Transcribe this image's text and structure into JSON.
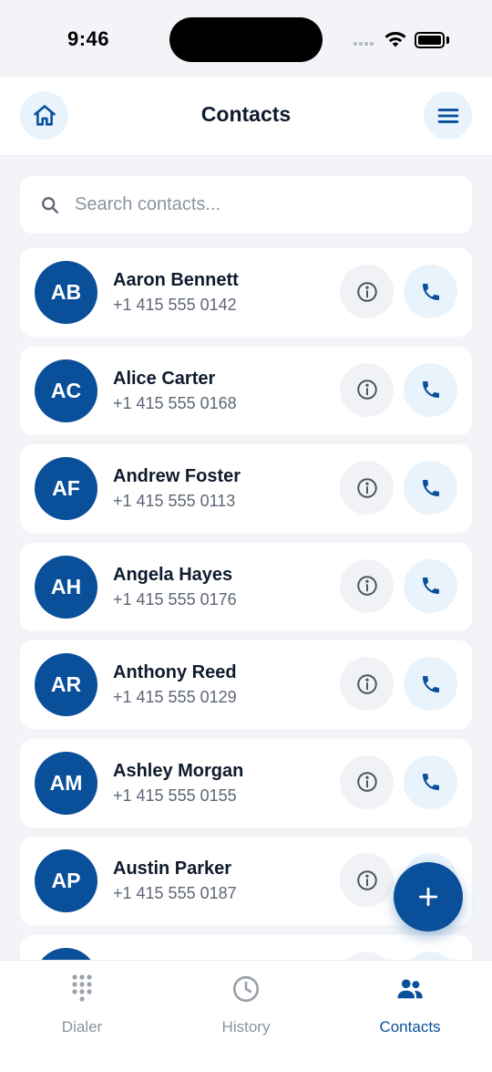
{
  "status_bar": {
    "time": "9:46"
  },
  "header": {
    "title": "Contacts",
    "home_icon": "home-icon",
    "menu_icon": "menu-icon"
  },
  "search": {
    "placeholder": "Search contacts...",
    "value": ""
  },
  "contacts": [
    {
      "initials": "AB",
      "name": "Aaron Bennett",
      "phone": "+1 415 555 0142"
    },
    {
      "initials": "AC",
      "name": "Alice Carter",
      "phone": "+1 415 555 0168"
    },
    {
      "initials": "AF",
      "name": "Andrew Foster",
      "phone": "+1 415 555 0113"
    },
    {
      "initials": "AH",
      "name": "Angela Hayes",
      "phone": "+1 415 555 0176"
    },
    {
      "initials": "AR",
      "name": "Anthony Reed",
      "phone": "+1 415 555 0129"
    },
    {
      "initials": "AM",
      "name": "Ashley Morgan",
      "phone": "+1 415 555 0155"
    },
    {
      "initials": "AP",
      "name": "Austin Parker",
      "phone": "+1 415 555 0187"
    },
    {
      "initials": "",
      "name": "",
      "phone": ""
    }
  ],
  "bottom_nav": {
    "items": [
      {
        "label": "Dialer",
        "icon": "dialpad-icon",
        "active": false
      },
      {
        "label": "History",
        "icon": "clock-icon",
        "active": false
      },
      {
        "label": "Contacts",
        "icon": "people-icon",
        "active": true
      }
    ]
  },
  "colors": {
    "accent": "#0a4f9a",
    "accent_light": "#e8f3fc",
    "background": "#f2f4f8"
  }
}
